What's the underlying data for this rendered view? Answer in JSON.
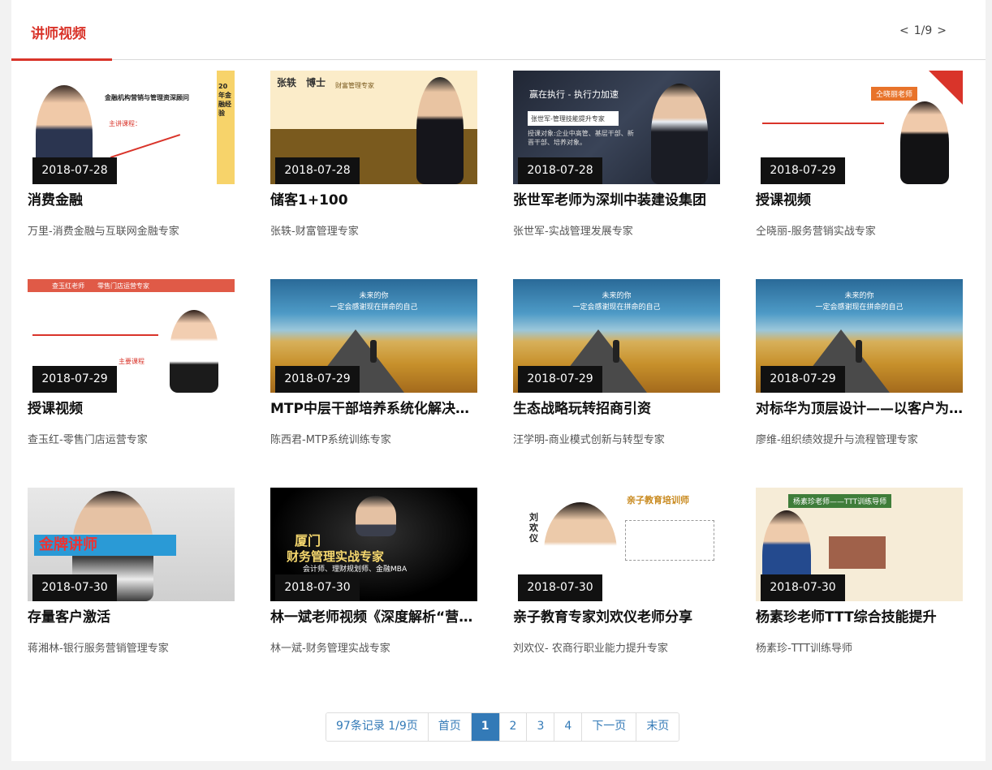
{
  "header": {
    "title": "讲师视频",
    "pager_prev": "<",
    "pager_status": "1/9",
    "pager_next": ">"
  },
  "thumb_text": {
    "c1_headline": "金融机构营销与管理资深顾问",
    "c1_side": "20年金融经验",
    "c1_course": "主讲课程：",
    "c2_name": "张轶　博士",
    "c2_tag": "财富管理专家",
    "c3_top": "赢在执行 - 执行力加速",
    "c3_name": "张世军-管理技能提升专家",
    "c3_body": "授课对象:企业中高管、基层干部、新晋干部、培养对象。",
    "c4_name": "仝晓丽老师",
    "c5_banner": "查玉红老师　　零售门店运营专家",
    "c5_tag": "主要课程",
    "road_verse": "未来的你\n一定会感谢现在拼命的自己",
    "c9_banner": "金牌讲师",
    "c10_title": "厦门",
    "c10_sub": "财务管理实战专家",
    "c10_cred": "会计师、理财规划师、金融MBA",
    "c11_name": "刘欢仪",
    "c11_title": "亲子教育培训师",
    "c12_name": "杨素珍老师——TTT训练导师"
  },
  "cards": [
    {
      "date": "2018-07-28",
      "title": "消费金融",
      "author": "万里-消费金融与互联网金融专家"
    },
    {
      "date": "2018-07-28",
      "title": "储客1+100",
      "author": "张轶-财富管理专家"
    },
    {
      "date": "2018-07-28",
      "title": "张世军老师为深圳中装建设集团",
      "author": "张世军-实战管理发展专家"
    },
    {
      "date": "2018-07-29",
      "title": "授课视频",
      "author": "仝晓丽-服务营销实战专家"
    },
    {
      "date": "2018-07-29",
      "title": "授课视频",
      "author": "查玉红-零售门店运营专家"
    },
    {
      "date": "2018-07-29",
      "title": "MTP中层干部培养系统化解决方案",
      "author": "陈西君-MTP系统训练专家"
    },
    {
      "date": "2018-07-29",
      "title": "生态战略玩转招商引资",
      "author": "汪学明-商业模式创新与转型专家"
    },
    {
      "date": "2018-07-29",
      "title": "对标华为顶层设计——以客户为中心",
      "author": "廖维-组织绩效提升与流程管理专家"
    },
    {
      "date": "2018-07-30",
      "title": "存量客户激活",
      "author": "蒋湘林-银行服务营销管理专家"
    },
    {
      "date": "2018-07-30",
      "title": "林一斌老师视频《深度解析“营改增”》",
      "author": "林一斌-财务管理实战专家"
    },
    {
      "date": "2018-07-30",
      "title": "亲子教育专家刘欢仪老师分享",
      "author": "刘欢仪- 农商行职业能力提升专家"
    },
    {
      "date": "2018-07-30",
      "title": "杨素珍老师TTT综合技能提升",
      "author": "杨素珍-TTT训练导师"
    }
  ],
  "pagination": {
    "info": "97条记录 1/9页",
    "first": "首页",
    "pages": [
      "1",
      "2",
      "3",
      "4"
    ],
    "next": "下一页",
    "last": "末页"
  }
}
